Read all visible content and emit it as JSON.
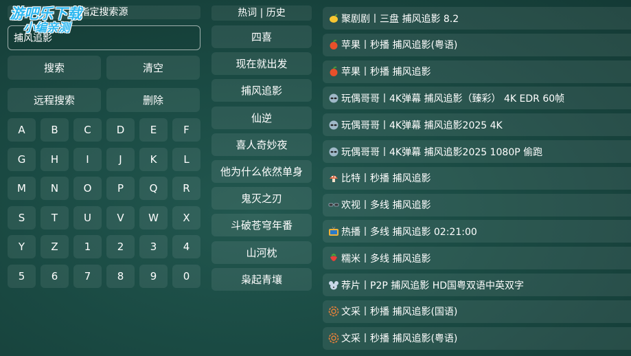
{
  "watermark": {
    "line1": "游吧乐下载",
    "line2": "小编亲测"
  },
  "left": {
    "source_title": "指定搜索源",
    "search_value": "捕风追影",
    "buttons": {
      "search": "搜索",
      "clear": "清空",
      "remote_search": "远程搜索",
      "delete": "删除"
    },
    "keys": [
      "A",
      "B",
      "C",
      "D",
      "E",
      "F",
      "G",
      "H",
      "I",
      "J",
      "K",
      "L",
      "M",
      "N",
      "O",
      "P",
      "Q",
      "R",
      "S",
      "T",
      "U",
      "V",
      "W",
      "X",
      "Y",
      "Z",
      "1",
      "2",
      "3",
      "4",
      "5",
      "6",
      "7",
      "8",
      "9",
      "0"
    ]
  },
  "hot": {
    "header": "热词 | 历史",
    "items": [
      "四喜",
      "现在就出发",
      "捕风追影",
      "仙逆",
      "喜人奇妙夜",
      "他为什么依然单身",
      "鬼灭之刃",
      "斗破苍穹年番",
      "山河枕",
      "枭起青壤"
    ]
  },
  "results": [
    {
      "icon": "lemon-icon",
      "color": "#f7c531",
      "text": "聚剧剧丨三盘  捕风追影  8.2"
    },
    {
      "icon": "apple-icon",
      "color": "#e8502a",
      "text": "苹果丨秒播  捕风追影(粤语)"
    },
    {
      "icon": "apple-icon",
      "color": "#e8502a",
      "text": "苹果丨秒播  捕风追影"
    },
    {
      "icon": "alien-icon",
      "color": "#9fb8c8",
      "text": "玩偶哥哥丨4K弹幕  捕风追影（臻彩）  4K EDR 60帧"
    },
    {
      "icon": "alien-icon",
      "color": "#9fb8c8",
      "text": "玩偶哥哥丨4K弹幕  捕风追影2025  4K"
    },
    {
      "icon": "alien-icon",
      "color": "#9fb8c8",
      "text": "玩偶哥哥丨4K弹幕  捕风追影2025  1080P 偷跑"
    },
    {
      "icon": "mushroom-icon",
      "color": "#e0704a",
      "text": "比特丨秒播  捕风追影"
    },
    {
      "icon": "glasses-icon",
      "color": "#8a9aa8",
      "text": "欢视丨多线  捕风追影"
    },
    {
      "icon": "tv-icon",
      "color": "#f2b33a",
      "text": "热播丨多线  捕风追影  02:21:00"
    },
    {
      "icon": "strawberry-icon",
      "color": "#e8413a",
      "text": "糯米丨多线  捕风追影"
    },
    {
      "icon": "mouse-icon",
      "color": "#c8d8e8",
      "text": "荐片丨P2P  捕风追影  HD国粤双语中英双字"
    },
    {
      "icon": "rosette-icon",
      "color": "#e8803a",
      "text": "文采丨秒播  捕风追影(国语)"
    },
    {
      "icon": "rosette-icon",
      "color": "#e8803a",
      "text": "文采丨秒播  捕风追影(粤语)"
    }
  ]
}
